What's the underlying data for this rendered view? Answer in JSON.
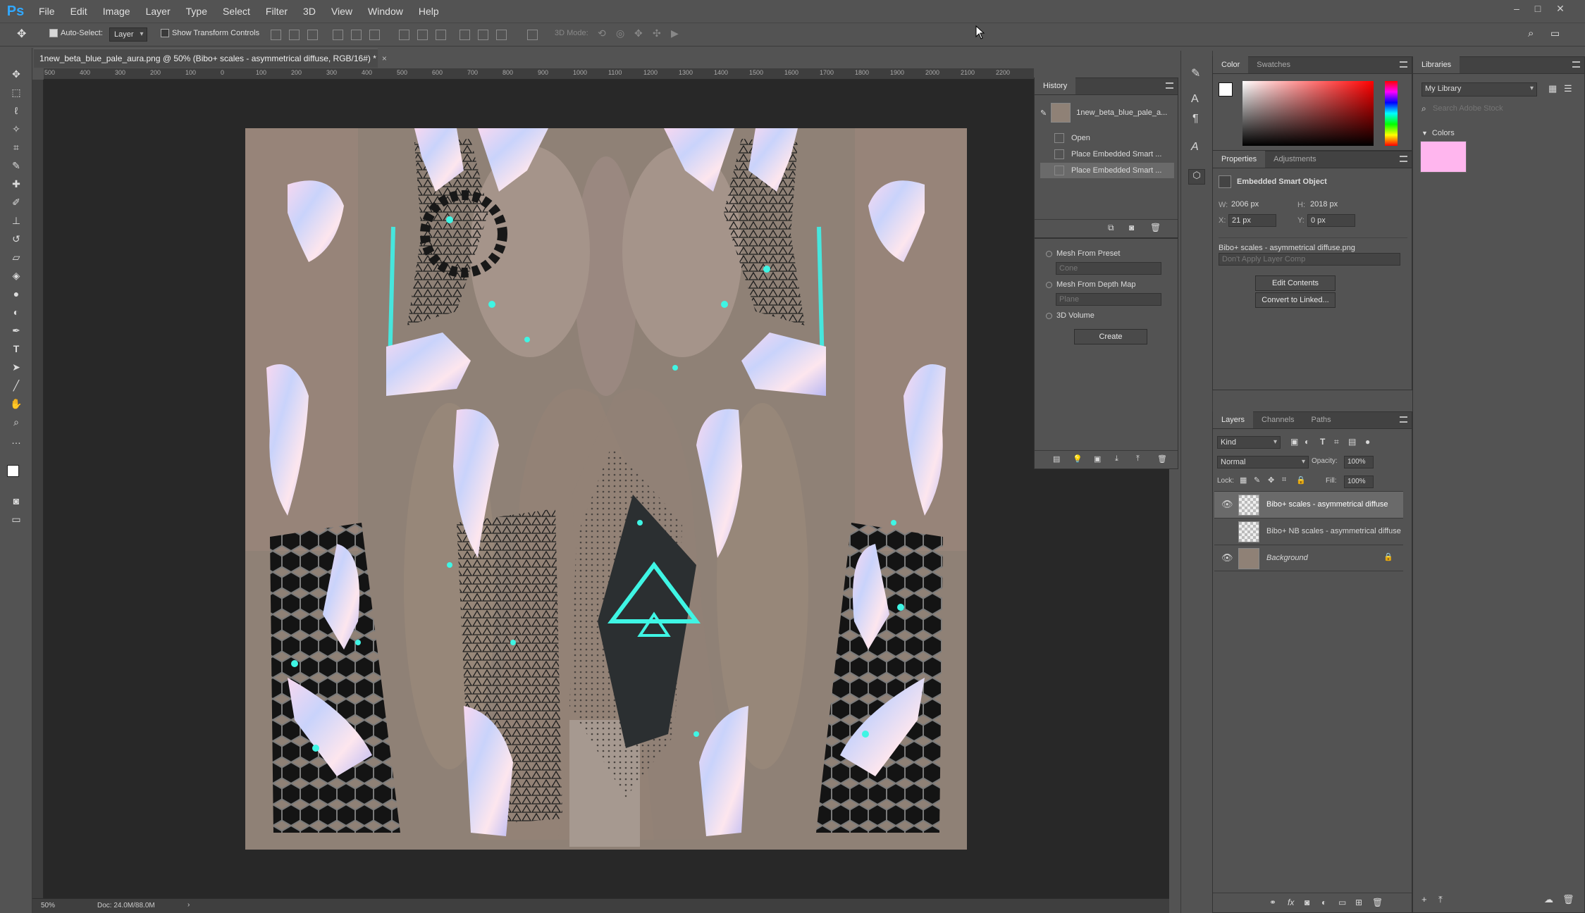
{
  "app": {
    "logo": "Ps",
    "menus": [
      "File",
      "Edit",
      "Image",
      "Layer",
      "Type",
      "Select",
      "Filter",
      "3D",
      "View",
      "Window",
      "Help"
    ]
  },
  "options": {
    "auto_select": "Auto-Select:",
    "layer_select": "Layer",
    "show_transform": "Show Transform Controls",
    "mode_3d": "3D Mode:"
  },
  "document": {
    "tab_title": "1new_beta_blue_pale_aura.png @ 50% (Bibo+ scales - asymmetrical diffuse, RGB/16#) *",
    "close": "×",
    "zoom": "50%",
    "doc_size": "Doc: 24.0M/88.0M"
  },
  "ruler": {
    "labels": [
      "500",
      "400",
      "300",
      "200",
      "100",
      "0",
      "100",
      "200",
      "300",
      "400",
      "500",
      "600",
      "700",
      "800",
      "900",
      "1000",
      "1100",
      "1200",
      "1300",
      "1400",
      "1500",
      "1600",
      "1700",
      "1800",
      "1900",
      "2000",
      "2100",
      "2200"
    ]
  },
  "history": {
    "title": "History",
    "snapshot": "1new_beta_blue_pale_a...",
    "items": [
      "Open",
      "Place Embedded Smart ...",
      "Place Embedded Smart ..."
    ]
  },
  "3d": {
    "options": [
      "Mesh From Preset",
      "Mesh From Depth Map",
      "3D Volume"
    ],
    "preset_value": "Cone",
    "depth_value": "Plane",
    "create": "Create"
  },
  "color": {
    "tabs": [
      "Color",
      "Swatches"
    ],
    "accent": "#ff0000"
  },
  "properties": {
    "tabs": [
      "Properties",
      "Adjustments"
    ],
    "type": "Embedded Smart Object",
    "w_label": "W:",
    "w": "2006 px",
    "h_label": "H:",
    "h": "2018 px",
    "x_label": "X:",
    "x": "21 px",
    "y_label": "Y:",
    "y": "0 px",
    "filename": "Bibo+ scales - asymmetrical diffuse.png",
    "layer_comp": "Don't Apply Layer Comp",
    "edit_contents": "Edit Contents",
    "convert": "Convert to Linked..."
  },
  "libraries": {
    "title": "Libraries",
    "library": "My Library",
    "search_placeholder": "Search Adobe Stock",
    "colors_heading": "Colors",
    "swatch": "#ffb6ee"
  },
  "layers": {
    "tabs": [
      "Layers",
      "Channels",
      "Paths"
    ],
    "filter": "Kind",
    "blend": "Normal",
    "opacity_label": "Opacity:",
    "opacity": "100%",
    "lock_label": "Lock:",
    "fill_label": "Fill:",
    "fill": "100%",
    "items": [
      {
        "name": "Bibo+ scales - asymmetrical diffuse"
      },
      {
        "name": "Bibo+ NB scales - asymmetrical diffuse"
      },
      {
        "name": "Background"
      }
    ]
  }
}
